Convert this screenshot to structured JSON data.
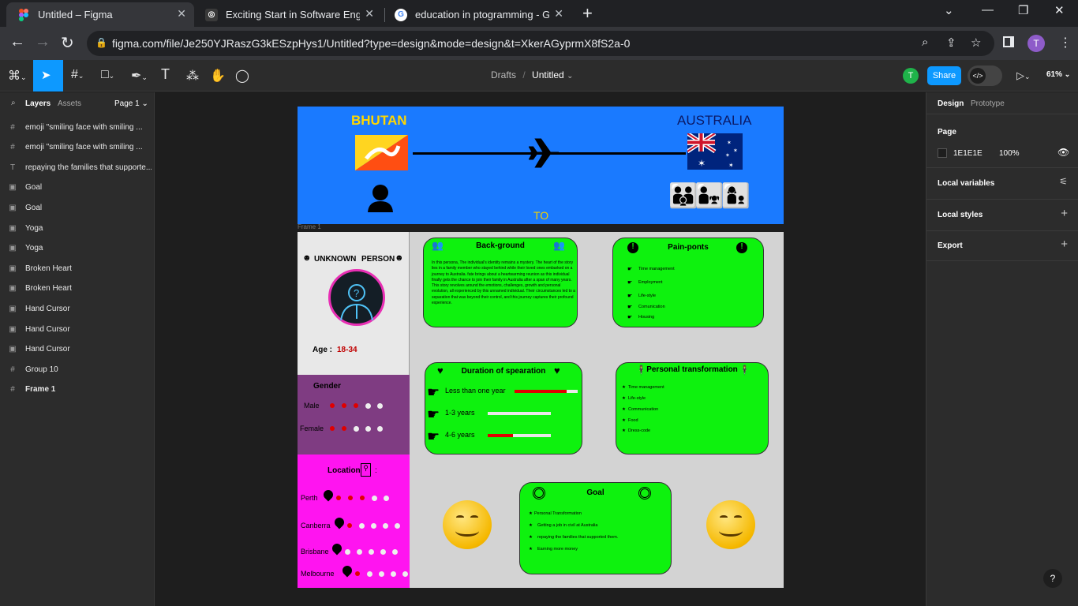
{
  "browser": {
    "tabs": [
      {
        "title": "Untitled – Figma",
        "active": true
      },
      {
        "title": "Exciting Start in Software Engine",
        "active": false
      },
      {
        "title": "education in ptogramming - Goo",
        "active": false
      }
    ],
    "url": "figma.com/file/Je250YJRaszG3kESzpHys1/Untitled?type=design&mode=design&t=XkerAGyprmX8fS2a-0",
    "profile_initial": "T"
  },
  "figma": {
    "breadcrumb_drafts": "Drafts",
    "breadcrumb_sep": "/",
    "file_name": "Untitled",
    "user_initial": "T",
    "share_label": "Share",
    "zoom": "61%",
    "left_tabs": {
      "layers": "Layers",
      "assets": "Assets",
      "page": "Page 1"
    },
    "layers": [
      {
        "icon": "grid",
        "name": "emoji \"smiling face with smiling ..."
      },
      {
        "icon": "grid",
        "name": "emoji \"smiling face with smiling ..."
      },
      {
        "icon": "text",
        "name": "repaying the families that supporte..."
      },
      {
        "icon": "image",
        "name": "Goal"
      },
      {
        "icon": "image",
        "name": "Goal"
      },
      {
        "icon": "image",
        "name": "Yoga"
      },
      {
        "icon": "image",
        "name": "Yoga"
      },
      {
        "icon": "image",
        "name": "Broken Heart"
      },
      {
        "icon": "image",
        "name": "Broken Heart"
      },
      {
        "icon": "image",
        "name": "Hand Cursor"
      },
      {
        "icon": "image",
        "name": "Hand Cursor"
      },
      {
        "icon": "image",
        "name": "Hand Cursor"
      },
      {
        "icon": "grid",
        "name": "Group 10"
      },
      {
        "icon": "frame",
        "name": "Frame 1"
      }
    ],
    "right": {
      "tab_design": "Design",
      "tab_prototype": "Prototype",
      "page_label": "Page",
      "page_color": "1E1E1E",
      "page_opacity": "100%",
      "local_variables": "Local variables",
      "local_styles": "Local styles",
      "export": "Export"
    },
    "frame_label": "Frame 1"
  },
  "design": {
    "banner": {
      "from": "BHUTAN",
      "to": "AUSTRALIA",
      "to_word": "TO"
    },
    "profile": {
      "unknown": "UNKNOWN",
      "person": "PERSON",
      "age_label": "Age :",
      "age_value": "18-34"
    },
    "gender": {
      "title": "Gender",
      "male": "Male",
      "female": "Female",
      "male_level": 3,
      "female_level": 2,
      "scale": 5
    },
    "location": {
      "title": "Location",
      "colon": ":",
      "cities": [
        {
          "name": "Perth",
          "level": 3,
          "scale": 5
        },
        {
          "name": "Canberra",
          "level": 1,
          "scale": 5
        },
        {
          "name": "Brisbane",
          "level": 0,
          "scale": 5
        },
        {
          "name": "Melbourne",
          "level": 1,
          "scale": 5
        }
      ]
    },
    "background": {
      "title": "Back-ground",
      "text": "In this persona, The individual's identity remains a mystery. The heart of the story lies in a family member who stayed behind while their loved ones embarked on a journey to Australia. fate brings about a heartwarming reunion as this individual finally gets the chance to join their family in Australia after a span of many years. This story revolves around the emotions, challenges, growth and personal evolution, all experienced by this unnamed individual. Their circumstances led to a separation that was beyond their control, and this journey captures their profound experience."
    },
    "pain_points": {
      "title": "Pain-ponts",
      "items": [
        "Time management",
        "Employment",
        "Life-style",
        "Comunication",
        "Housing"
      ]
    },
    "duration": {
      "title": "Duration of spearation",
      "items": [
        {
          "label": "Less than one year",
          "fill": 0.83
        },
        {
          "label": "1-3 years",
          "fill": 0
        },
        {
          "label": "4-6 years",
          "fill": 0.4
        }
      ]
    },
    "transformation": {
      "title": "Personal transformation",
      "items": [
        "Time management",
        "Life-style",
        "Communication",
        "Food",
        "Dress-code"
      ]
    },
    "goal": {
      "title": "Goal",
      "items": [
        "Personal Transformation",
        "Getting a job in civil at Australia",
        "repaying the families that supported them.",
        "Earning more money"
      ]
    }
  }
}
